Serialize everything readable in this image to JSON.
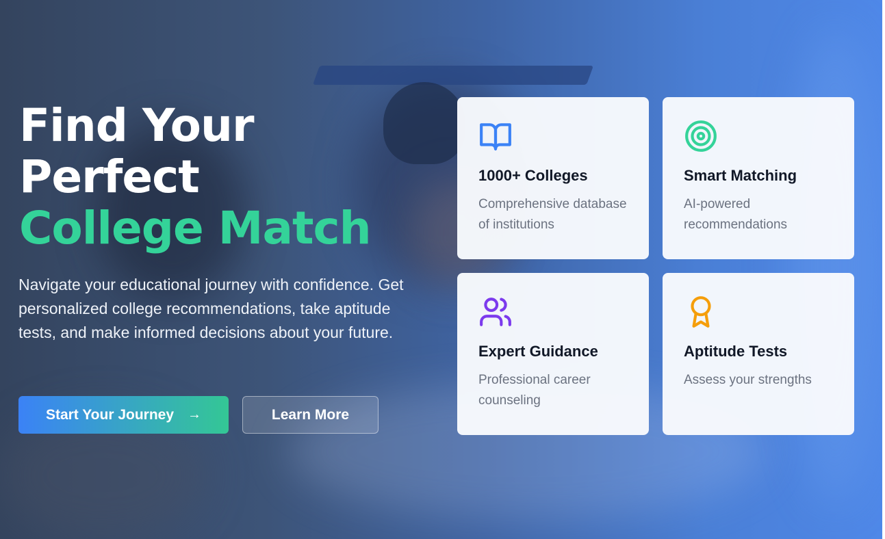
{
  "hero": {
    "title_line1": "Find Your",
    "title_line2": "Perfect",
    "title_accent": "College Match",
    "subtitle": "Navigate your educational journey with confidence. Get personalized college recommendations, take aptitude tests, and make informed decisions about your future.",
    "primary_button": "Start Your Journey",
    "secondary_button": "Learn More"
  },
  "features": [
    {
      "icon": "book-open-icon",
      "color": "#3b82f6",
      "title": "1000+ Colleges",
      "description": "Comprehensive database of institutions"
    },
    {
      "icon": "target-icon",
      "color": "#34d399",
      "title": "Smart Matching",
      "description": "AI-powered recommendations"
    },
    {
      "icon": "users-icon",
      "color": "#7c3aed",
      "title": "Expert Guidance",
      "description": "Professional career counseling"
    },
    {
      "icon": "award-icon",
      "color": "#f59e0b",
      "title": "Aptitude Tests",
      "description": "Assess your strengths"
    }
  ],
  "colors": {
    "accent_green": "#34d399",
    "accent_blue": "#3b82f6"
  }
}
